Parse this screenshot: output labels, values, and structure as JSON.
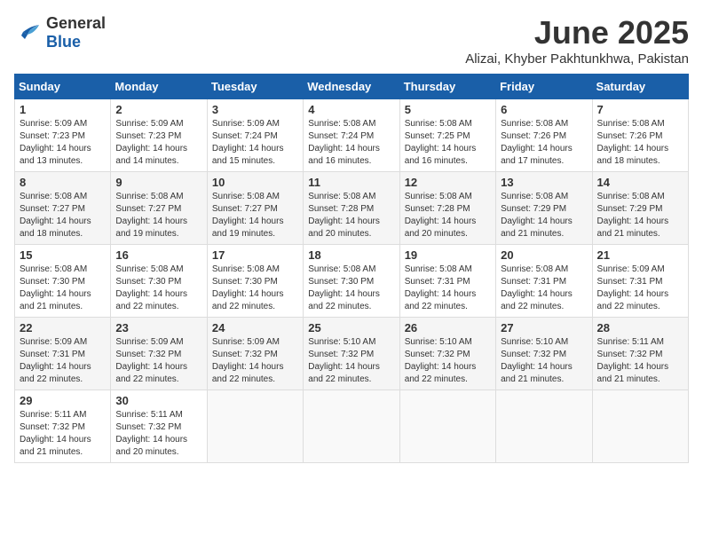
{
  "header": {
    "logo_general": "General",
    "logo_blue": "Blue",
    "month": "June 2025",
    "location": "Alizai, Khyber Pakhtunkhwa, Pakistan"
  },
  "columns": [
    "Sunday",
    "Monday",
    "Tuesday",
    "Wednesday",
    "Thursday",
    "Friday",
    "Saturday"
  ],
  "weeks": [
    [
      {
        "day": "1",
        "sunrise": "5:09 AM",
        "sunset": "7:23 PM",
        "daylight": "14 hours and 13 minutes."
      },
      {
        "day": "2",
        "sunrise": "5:09 AM",
        "sunset": "7:23 PM",
        "daylight": "14 hours and 14 minutes."
      },
      {
        "day": "3",
        "sunrise": "5:09 AM",
        "sunset": "7:24 PM",
        "daylight": "14 hours and 15 minutes."
      },
      {
        "day": "4",
        "sunrise": "5:08 AM",
        "sunset": "7:24 PM",
        "daylight": "14 hours and 16 minutes."
      },
      {
        "day": "5",
        "sunrise": "5:08 AM",
        "sunset": "7:25 PM",
        "daylight": "14 hours and 16 minutes."
      },
      {
        "day": "6",
        "sunrise": "5:08 AM",
        "sunset": "7:26 PM",
        "daylight": "14 hours and 17 minutes."
      },
      {
        "day": "7",
        "sunrise": "5:08 AM",
        "sunset": "7:26 PM",
        "daylight": "14 hours and 18 minutes."
      }
    ],
    [
      {
        "day": "8",
        "sunrise": "5:08 AM",
        "sunset": "7:27 PM",
        "daylight": "14 hours and 18 minutes."
      },
      {
        "day": "9",
        "sunrise": "5:08 AM",
        "sunset": "7:27 PM",
        "daylight": "14 hours and 19 minutes."
      },
      {
        "day": "10",
        "sunrise": "5:08 AM",
        "sunset": "7:27 PM",
        "daylight": "14 hours and 19 minutes."
      },
      {
        "day": "11",
        "sunrise": "5:08 AM",
        "sunset": "7:28 PM",
        "daylight": "14 hours and 20 minutes."
      },
      {
        "day": "12",
        "sunrise": "5:08 AM",
        "sunset": "7:28 PM",
        "daylight": "14 hours and 20 minutes."
      },
      {
        "day": "13",
        "sunrise": "5:08 AM",
        "sunset": "7:29 PM",
        "daylight": "14 hours and 21 minutes."
      },
      {
        "day": "14",
        "sunrise": "5:08 AM",
        "sunset": "7:29 PM",
        "daylight": "14 hours and 21 minutes."
      }
    ],
    [
      {
        "day": "15",
        "sunrise": "5:08 AM",
        "sunset": "7:30 PM",
        "daylight": "14 hours and 21 minutes."
      },
      {
        "day": "16",
        "sunrise": "5:08 AM",
        "sunset": "7:30 PM",
        "daylight": "14 hours and 22 minutes."
      },
      {
        "day": "17",
        "sunrise": "5:08 AM",
        "sunset": "7:30 PM",
        "daylight": "14 hours and 22 minutes."
      },
      {
        "day": "18",
        "sunrise": "5:08 AM",
        "sunset": "7:30 PM",
        "daylight": "14 hours and 22 minutes."
      },
      {
        "day": "19",
        "sunrise": "5:08 AM",
        "sunset": "7:31 PM",
        "daylight": "14 hours and 22 minutes."
      },
      {
        "day": "20",
        "sunrise": "5:08 AM",
        "sunset": "7:31 PM",
        "daylight": "14 hours and 22 minutes."
      },
      {
        "day": "21",
        "sunrise": "5:09 AM",
        "sunset": "7:31 PM",
        "daylight": "14 hours and 22 minutes."
      }
    ],
    [
      {
        "day": "22",
        "sunrise": "5:09 AM",
        "sunset": "7:31 PM",
        "daylight": "14 hours and 22 minutes."
      },
      {
        "day": "23",
        "sunrise": "5:09 AM",
        "sunset": "7:32 PM",
        "daylight": "14 hours and 22 minutes."
      },
      {
        "day": "24",
        "sunrise": "5:09 AM",
        "sunset": "7:32 PM",
        "daylight": "14 hours and 22 minutes."
      },
      {
        "day": "25",
        "sunrise": "5:10 AM",
        "sunset": "7:32 PM",
        "daylight": "14 hours and 22 minutes."
      },
      {
        "day": "26",
        "sunrise": "5:10 AM",
        "sunset": "7:32 PM",
        "daylight": "14 hours and 22 minutes."
      },
      {
        "day": "27",
        "sunrise": "5:10 AM",
        "sunset": "7:32 PM",
        "daylight": "14 hours and 21 minutes."
      },
      {
        "day": "28",
        "sunrise": "5:11 AM",
        "sunset": "7:32 PM",
        "daylight": "14 hours and 21 minutes."
      }
    ],
    [
      {
        "day": "29",
        "sunrise": "5:11 AM",
        "sunset": "7:32 PM",
        "daylight": "14 hours and 21 minutes."
      },
      {
        "day": "30",
        "sunrise": "5:11 AM",
        "sunset": "7:32 PM",
        "daylight": "14 hours and 20 minutes."
      },
      null,
      null,
      null,
      null,
      null
    ]
  ]
}
